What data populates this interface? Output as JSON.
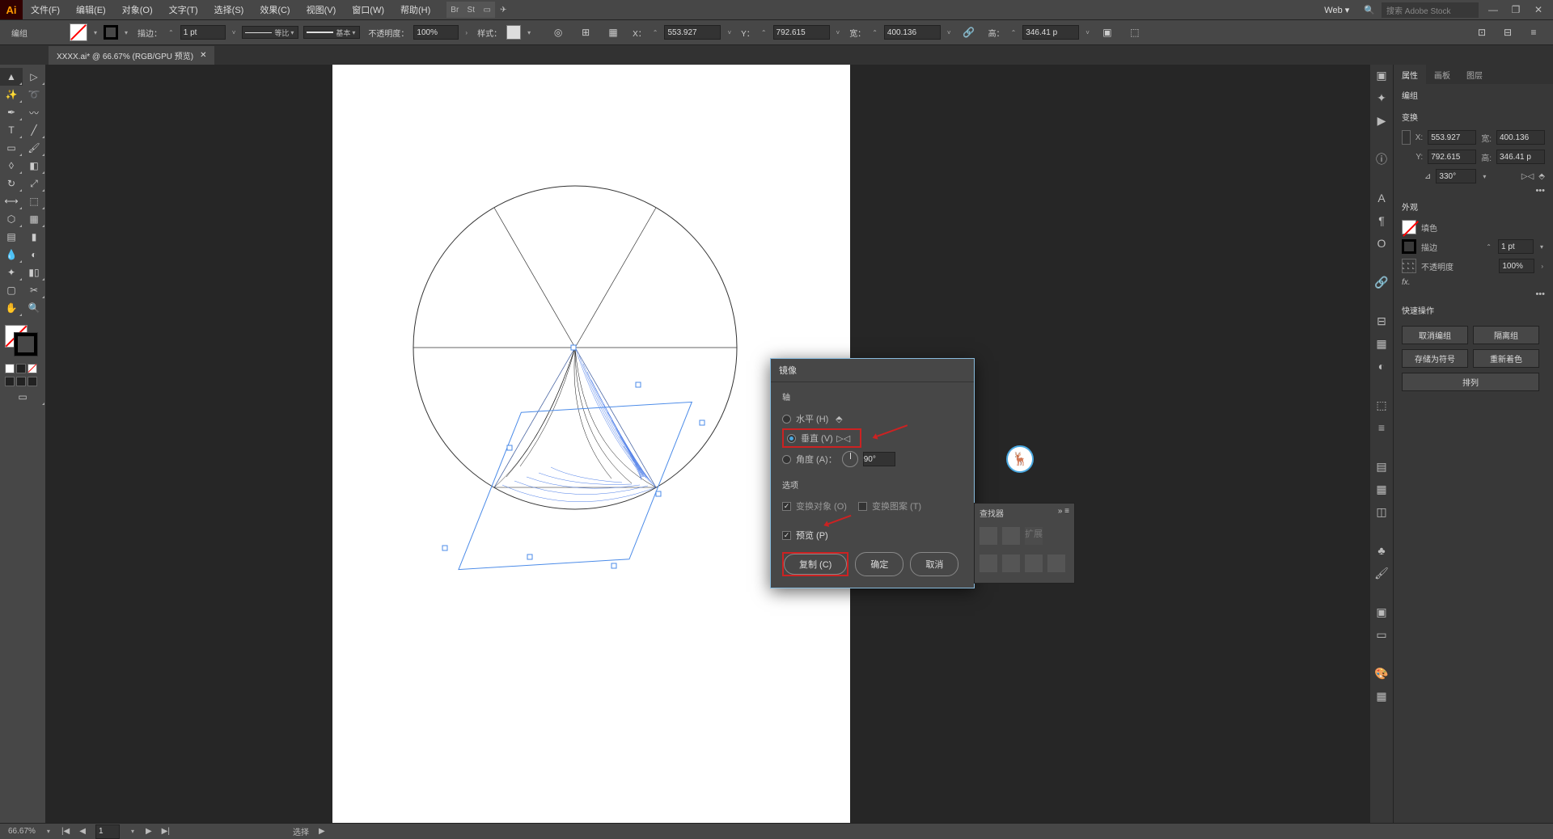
{
  "menu": {
    "file": "文件(F)",
    "edit": "编辑(E)",
    "object": "对象(O)",
    "type": "文字(T)",
    "select": "选择(S)",
    "effect": "效果(C)",
    "view": "视图(V)",
    "window": "窗口(W)",
    "help": "帮助(H)"
  },
  "topright": {
    "workspace": "Web",
    "search_ph": "搜索 Adobe Stock"
  },
  "control": {
    "group_label": "编组",
    "stroke_label": "描边：",
    "stroke_pt": "1 pt",
    "style1": "等比",
    "style2": "基本",
    "opacity_label": "不透明度：",
    "opacity": "100%",
    "styles_label": "样式：",
    "x_label": "X：",
    "x": "553.927",
    "y_label": "Y：",
    "y": "792.615",
    "w_label": "宽：",
    "w": "400.136",
    "h_label": "高：",
    "h": "346.41 p"
  },
  "tab": {
    "name": "XXXX.ai* @ 66.67% (RGB/GPU 预览)"
  },
  "props": {
    "tabs": {
      "properties": "属性",
      "artboards": "画板",
      "layers": "图层"
    },
    "group_sec": "编组",
    "transform_sec": "变换",
    "x": "553.927",
    "y": "792.615",
    "w": "400.136",
    "h": "346.41 p",
    "rotate": "330°",
    "appearance_sec": "外观",
    "fill_label": "填色",
    "stroke_label": "描边",
    "stroke_pt": "1 pt",
    "opacity_label": "不透明度",
    "opacity": "100%",
    "fx": "fx.",
    "quick_sec": "快速操作",
    "ungroup": "取消编组",
    "isolate": "隔离组",
    "savesymbol": "存储为符号",
    "recolor": "重新着色",
    "align": "排列"
  },
  "dialog": {
    "title": "镜像",
    "axis_sec": "轴",
    "horiz": "水平 (H)",
    "vert": "垂直 (V)",
    "angle": "角度 (A)：",
    "angle_value": "90°",
    "options_sec": "选项",
    "transform_obj": "变换对象 (O)",
    "transform_pat": "变换图案 (T)",
    "preview": "预览 (P)",
    "copy": "复制 (C)",
    "ok": "确定",
    "cancel": "取消"
  },
  "status": {
    "zoom": "66.67%",
    "artboard": "1",
    "tool": "选择"
  },
  "pf": {
    "title": "查找器",
    "expand": "扩展"
  }
}
